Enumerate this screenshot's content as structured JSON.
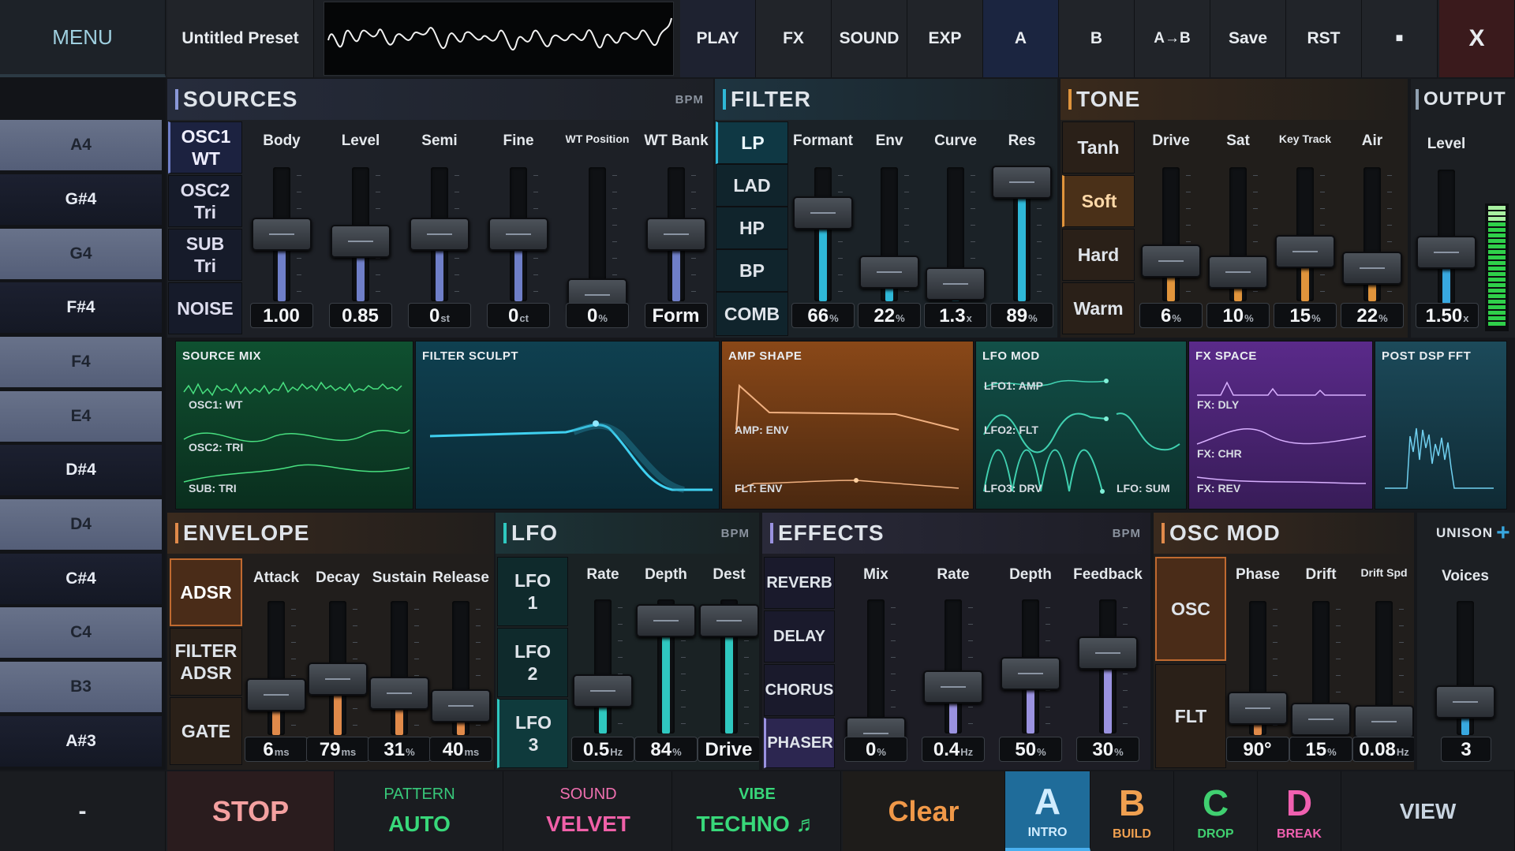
{
  "topbar": {
    "menu": "MENU",
    "preset": "Untitled Preset",
    "tabs": [
      "PLAY",
      "FX",
      "SOUND",
      "EXP"
    ],
    "ab": [
      "A",
      "B",
      "A→B"
    ],
    "save": "Save",
    "reset": "RST",
    "stop_square": "■",
    "close": "X"
  },
  "keys": [
    "A4",
    "G#4",
    "G4",
    "F#4",
    "F4",
    "E4",
    "D#4",
    "D4",
    "C#4",
    "C4",
    "B3",
    "A#3"
  ],
  "keys_bottom": "-",
  "sources": {
    "title": "SOURCES",
    "bpm": "BPM",
    "buttons": [
      "OSC1\nWT",
      "OSC2\nTri",
      "SUB\nTri",
      "NOISE"
    ],
    "labels": [
      "Body",
      "Level",
      "Semi",
      "Fine",
      "WT Position",
      "WT Bank"
    ],
    "values": [
      "1.00",
      "0.85",
      "0",
      "0",
      "0",
      "Form"
    ],
    "units": [
      "",
      "",
      "st",
      "ct",
      "%",
      ""
    ],
    "levels": [
      0.5,
      0.45,
      0.5,
      0.5,
      0.05,
      0.5
    ]
  },
  "filter": {
    "title": "FILTER",
    "buttons": [
      "LP",
      "LAD",
      "HP",
      "BP",
      "COMB"
    ],
    "labels": [
      "Formant",
      "Env",
      "Curve",
      "Res"
    ],
    "values": [
      "66",
      "22",
      "1.3",
      "89"
    ],
    "units": [
      "%",
      "%",
      "x",
      "%"
    ],
    "levels": [
      0.66,
      0.22,
      0.13,
      0.89
    ]
  },
  "tone": {
    "title": "TONE",
    "buttons": [
      "Tanh",
      "Soft",
      "Hard",
      "Warm"
    ],
    "labels": [
      "Drive",
      "Sat",
      "Key Track",
      "Air"
    ],
    "values": [
      "6",
      "10",
      "15",
      "22"
    ],
    "units": [
      "%",
      "%",
      "%",
      "%"
    ],
    "levels": [
      0.3,
      0.22,
      0.37,
      0.25
    ]
  },
  "output": {
    "title": "OUTPUT",
    "label": "Level",
    "value": "1.50",
    "unit": "x",
    "level": 0.38
  },
  "panels": {
    "source_mix": {
      "title": "SOURCE MIX",
      "labels": [
        "OSC1: WT",
        "OSC2: TRI",
        "SUB: TRI"
      ]
    },
    "filter_sculpt": {
      "title": "FILTER SCULPT"
    },
    "amp_shape": {
      "title": "AMP SHAPE",
      "labels": [
        "AMP: ENV",
        "FLT: ENV"
      ]
    },
    "lfo_mod": {
      "title": "LFO MOD",
      "labels": [
        "LFO1: AMP",
        "LFO2: FLT",
        "LFO3: DRV",
        "LFO: SUM"
      ]
    },
    "fx_space": {
      "title": "FX SPACE",
      "labels": [
        "FX: DLY",
        "FX: CHR",
        "FX: REV"
      ]
    },
    "post_fft": {
      "title": "POST DSP FFT"
    }
  },
  "envelope": {
    "title": "ENVELOPE",
    "buttons": [
      "ADSR",
      "FILTER\nADSR",
      "GATE"
    ],
    "labels": [
      "Attack",
      "Decay",
      "Sustain",
      "Release"
    ],
    "values": [
      "6",
      "79",
      "31",
      "40"
    ],
    "units": [
      "ms",
      "ms",
      "%",
      "ms"
    ],
    "levels": [
      0.3,
      0.42,
      0.31,
      0.22
    ]
  },
  "lfo": {
    "title": "LFO",
    "bpm": "BPM",
    "buttons": [
      "LFO\n1",
      "LFO\n2",
      "LFO\n3"
    ],
    "labels": [
      "Rate",
      "Depth",
      "Dest"
    ],
    "values": [
      "0.5",
      "84",
      "Drive"
    ],
    "units": [
      "Hz",
      "%",
      ""
    ],
    "levels": [
      0.32,
      0.84,
      0.84
    ]
  },
  "effects": {
    "title": "EFFECTS",
    "bpm": "BPM",
    "buttons": [
      "REVERB",
      "DELAY",
      "CHORUS",
      "PHASER"
    ],
    "labels": [
      "Mix",
      "Rate",
      "Depth",
      "Feedback"
    ],
    "values": [
      "0",
      "0.4",
      "50",
      "30"
    ],
    "units": [
      "%",
      "Hz",
      "%",
      "%"
    ],
    "levels": [
      0.0,
      0.35,
      0.45,
      0.6
    ]
  },
  "oscmod": {
    "title": "OSC MOD",
    "buttons": [
      "OSC",
      "FLT"
    ],
    "labels": [
      "Phase",
      "Drift",
      "Drift Spd"
    ],
    "values": [
      "90°",
      "15",
      "0.08"
    ],
    "units": [
      "",
      "%",
      "Hz"
    ],
    "levels": [
      0.2,
      0.12,
      0.1
    ]
  },
  "unison": {
    "title": "UNISON",
    "plus": "+",
    "label": "Voices",
    "value": "3",
    "level": 0.25
  },
  "bottom": {
    "stop": "STOP",
    "pattern": {
      "label": "PATTERN",
      "value": "AUTO"
    },
    "sound": {
      "label": "SOUND",
      "value": "VELVET"
    },
    "vibe": {
      "label": "VIBE",
      "value": "TECHNO ♬"
    },
    "clear": "Clear",
    "scenes": [
      {
        "letter": "A",
        "name": "INTRO"
      },
      {
        "letter": "B",
        "name": "BUILD"
      },
      {
        "letter": "C",
        "name": "DROP"
      },
      {
        "letter": "D",
        "name": "BREAK"
      }
    ],
    "view": "VIEW"
  },
  "colors": {
    "sources": "#6f7fc8",
    "filter": "#2fb8d8",
    "tone": "#e0943c",
    "envelope": "#e08a4a",
    "lfo": "#2fc8c0",
    "effects": "#9a92e0",
    "oscmod": "#e08a4a",
    "unison": "#38a8e0"
  }
}
